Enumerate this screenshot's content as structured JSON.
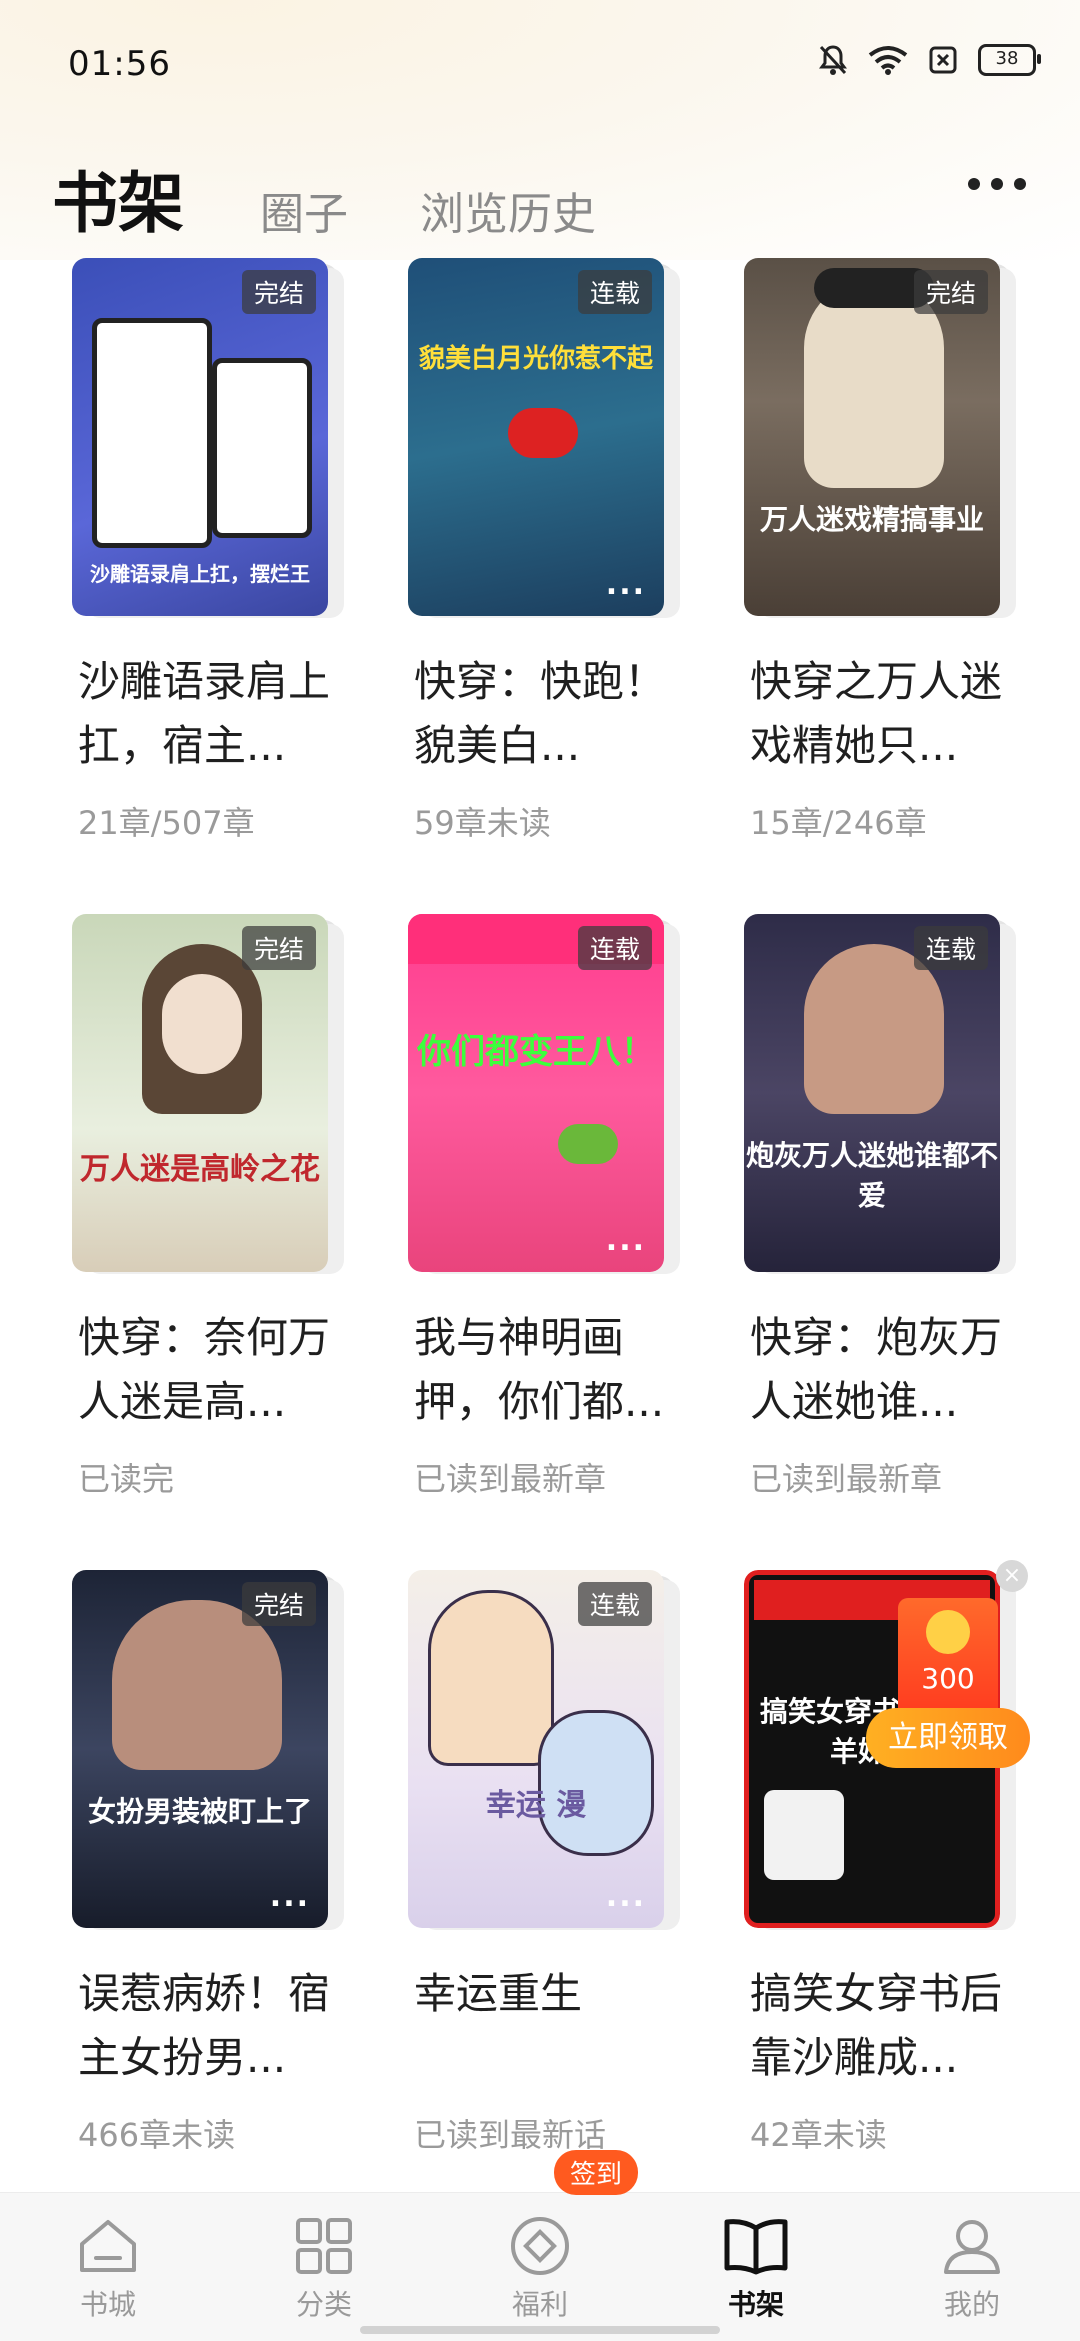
{
  "status_bar": {
    "time": "01:56",
    "battery": "38"
  },
  "header": {
    "active_tab": "书架",
    "tabs": [
      "圈子",
      "浏览历史"
    ]
  },
  "books": [
    {
      "title": "沙雕语录肩上扛，宿主...",
      "progress": "21章/507章",
      "badge": "完结",
      "cover_text": "沙雕语录肩上扛，摆烂王"
    },
    {
      "title": "快穿：快跑！貌美白...",
      "progress": "59章未读",
      "badge": "连载",
      "cover_text": "貌美白月光你惹不起"
    },
    {
      "title": "快穿之万人迷戏精她只...",
      "progress": "15章/246章",
      "badge": "完结",
      "cover_text": "万人迷戏精搞事业"
    },
    {
      "title": "快穿：奈何万人迷是高...",
      "progress": "已读完",
      "badge": "完结",
      "cover_text": "万人迷是高岭之花"
    },
    {
      "title": "我与神明画押，你们都...",
      "progress": "已读到最新章",
      "badge": "连载",
      "cover_text": "你们都变王八！"
    },
    {
      "title": "快穿：炮灰万人迷她谁...",
      "progress": "已读到最新章",
      "badge": "连载",
      "cover_text": "炮灰万人迷她谁都不爱"
    },
    {
      "title": "误惹病娇！宿主女扮男...",
      "progress": "466章未读",
      "badge": "完结",
      "cover_text": "女扮男装被盯上了"
    },
    {
      "title": "幸运重生",
      "progress": "已读到最新话",
      "badge": "连载",
      "cover_text": "幸运 漫"
    },
    {
      "title": "搞笑女穿书后靠沙雕成...",
      "progress": "42章未读",
      "badge": "",
      "cover_text": "搞笑女穿书靠沙雕 羊妹妹"
    }
  ],
  "float": {
    "coin_amount": "300",
    "claim_label": "立即领取"
  },
  "nav": {
    "items": [
      {
        "label": "书城",
        "icon": "home-icon"
      },
      {
        "label": "分类",
        "icon": "grid-icon"
      },
      {
        "label": "福利",
        "icon": "gift-icon"
      },
      {
        "label": "书架",
        "icon": "book-icon",
        "active": true
      },
      {
        "label": "我的",
        "icon": "user-icon"
      }
    ],
    "sign_badge": "签到"
  },
  "colors": {
    "active": "#111111",
    "inactive": "#9a9a9a",
    "accent": "#ff5a1f"
  }
}
